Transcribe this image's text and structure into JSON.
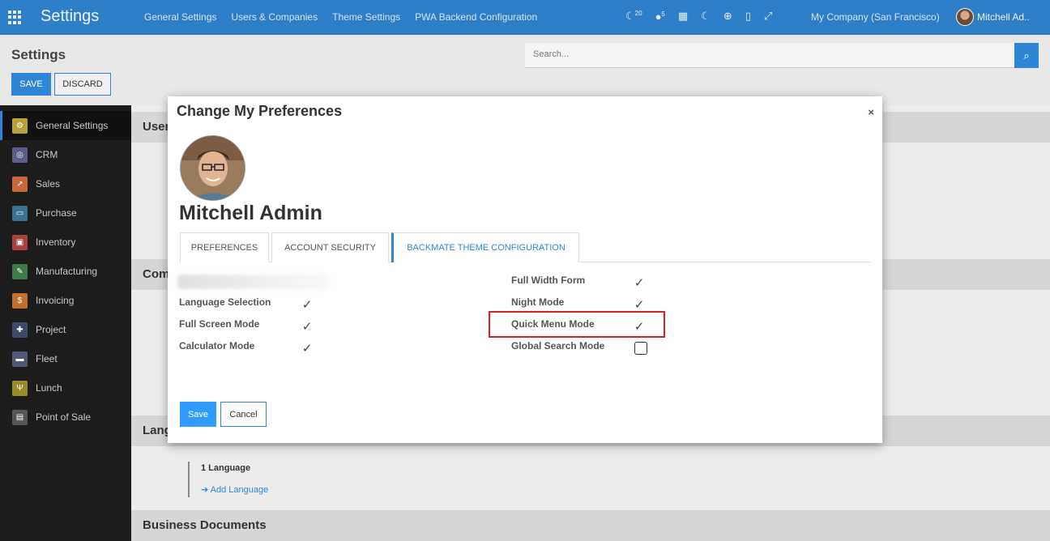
{
  "topbar": {
    "brand": "Settings",
    "menu": [
      "General Settings",
      "Users & Companies",
      "Theme Settings",
      "PWA Backend Configuration"
    ],
    "activity_count": "20",
    "message_count": "5",
    "company": "My Company (San Francisco)",
    "user": "Mitchell Ad.."
  },
  "control": {
    "title": "Settings",
    "save_label": "SAVE",
    "discard_label": "DISCARD",
    "search_placeholder": "Search..."
  },
  "sidebar": {
    "items": [
      {
        "label": "General Settings",
        "icon": "gear-icon",
        "color": "#b9a13a"
      },
      {
        "label": "CRM",
        "icon": "target-icon",
        "color": "#5a5c8a"
      },
      {
        "label": "Sales",
        "icon": "chart-icon",
        "color": "#c7683a"
      },
      {
        "label": "Purchase",
        "icon": "credit-card-icon",
        "color": "#3d6f8f"
      },
      {
        "label": "Inventory",
        "icon": "box-icon",
        "color": "#a8423a"
      },
      {
        "label": "Manufacturing",
        "icon": "wrench-icon",
        "color": "#3f7a4a"
      },
      {
        "label": "Invoicing",
        "icon": "invoice-icon",
        "color": "#c46d2c"
      },
      {
        "label": "Project",
        "icon": "puzzle-icon",
        "color": "#3d4a6a"
      },
      {
        "label": "Fleet",
        "icon": "car-icon",
        "color": "#4f5a78"
      },
      {
        "label": "Lunch",
        "icon": "cutlery-icon",
        "color": "#9a8a2a"
      },
      {
        "label": "Point of Sale",
        "icon": "store-icon",
        "color": "#555"
      }
    ]
  },
  "main": {
    "sections": [
      "Users",
      "Companies",
      "Languages",
      "Business Documents"
    ],
    "language_count": "1 Language",
    "add_language": "Add Language"
  },
  "modal": {
    "title": "Change My Preferences",
    "close": "×",
    "name": "Mitchell Admin",
    "tabs": [
      "PREFERENCES",
      "ACCOUNT SECURITY",
      "BACKMATE THEME CONFIGURATION"
    ],
    "left_options": [
      {
        "label": "Language Selection",
        "checked": true
      },
      {
        "label": "Full Screen Mode",
        "checked": true
      },
      {
        "label": "Calculator Mode",
        "checked": true
      }
    ],
    "right_options": [
      {
        "label": "Full Width Form",
        "checked": true
      },
      {
        "label": "Night Mode",
        "checked": true
      },
      {
        "label": "Quick Menu Mode",
        "checked": true
      },
      {
        "label": "Global Search Mode",
        "checked": false
      }
    ],
    "save_label": "Save",
    "cancel_label": "Cancel"
  },
  "colors": {
    "topbar": "#2f7fc8",
    "accent": "#2f86d6",
    "sidebar": "#1c1c1c",
    "highlight": "#dd2222"
  }
}
